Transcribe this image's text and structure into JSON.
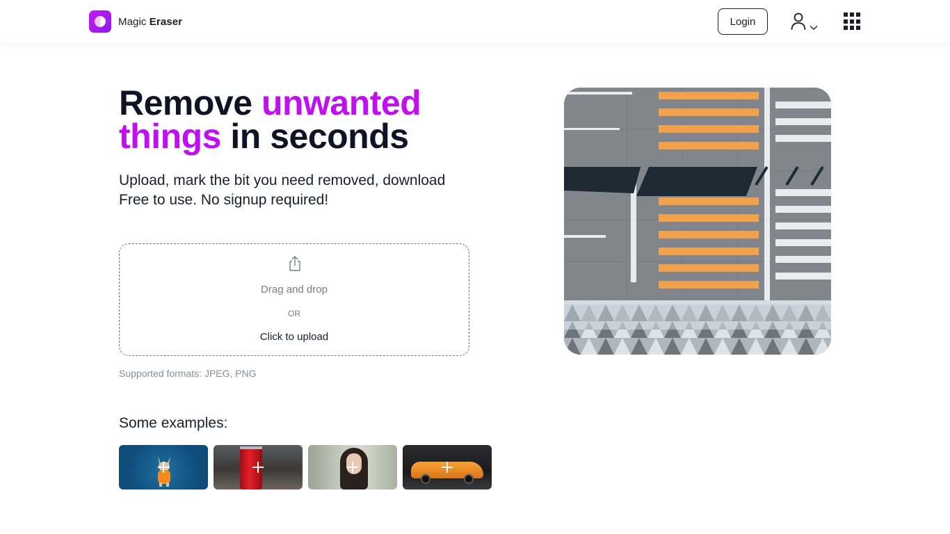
{
  "header": {
    "brand_regular": "Magic",
    "brand_bold": "Eraser",
    "login_label": "Login",
    "user_icon": "user-icon",
    "menu_icon": "apps-grid-icon"
  },
  "hero": {
    "headline_part1": "Remove ",
    "headline_accent1": "unwanted",
    "headline_accent2": "things",
    "headline_part2": " in seconds",
    "subtitle_line1": "Upload, mark the bit you need removed, download",
    "subtitle_line2": "Free to use. No signup required!"
  },
  "upload": {
    "icon": "upload-icon",
    "drag_text": "Drag and drop",
    "or_text": "OR",
    "click_text": "Click to upload",
    "formats_text": "Supported formats: JPEG, PNG"
  },
  "examples": {
    "title": "Some examples:",
    "items": [
      {
        "name": "dog-example"
      },
      {
        "name": "coke-can-example"
      },
      {
        "name": "woman-portrait-example"
      },
      {
        "name": "sports-car-example"
      }
    ]
  },
  "colors": {
    "accent": "#c00ff0",
    "text_dark": "#0f1324",
    "brand_gradient_start": "#c418f0",
    "brand_gradient_end": "#8a1cf0"
  }
}
